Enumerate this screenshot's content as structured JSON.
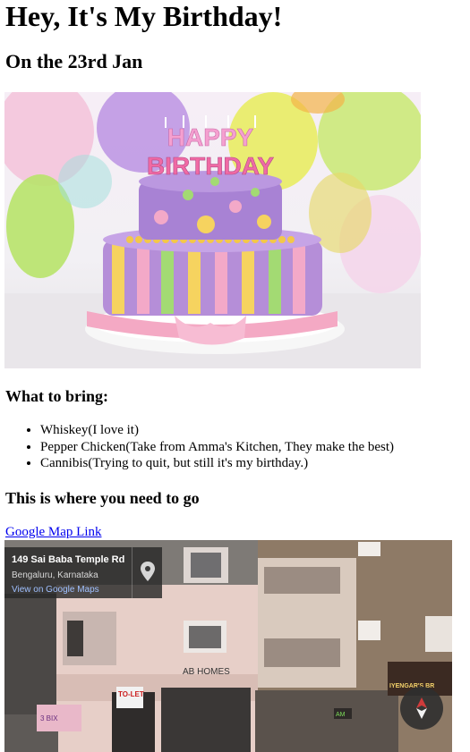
{
  "heading": "Hey, It's My Birthday!",
  "subheading": "On the 23rd Jan",
  "cake_image": {
    "candle_letters": [
      "HAPPY",
      "BIRTHDAY"
    ]
  },
  "bring_title": "What to bring:",
  "bring_items": [
    "Whiskey(I love it)",
    "Pepper Chicken(Take from Amma's Kitchen, They make the best)",
    "Cannibis(Trying to quit, but still it's my birthday.)"
  ],
  "go_title": "This is where you need to go",
  "map_link": "Google Map Link",
  "street_view": {
    "address": "149 Sai Baba Temple Rd",
    "city": "Bengaluru, Karnataka",
    "view_link": "View on Google Maps",
    "building_sign": "AB HOMES",
    "tolet_sign": "TO-LET",
    "shop_sign": "IYENGAR'S BR",
    "left_sign": "3 BIX",
    "small_sign": "AM"
  }
}
